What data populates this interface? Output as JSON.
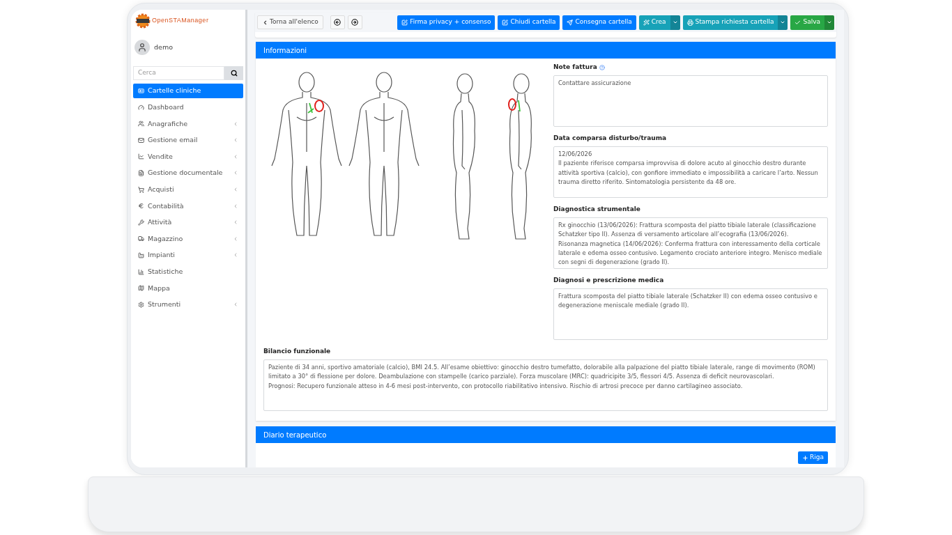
{
  "app": {
    "logo": "OpenSTAManager",
    "user": "demo",
    "search": {
      "placeholder": "Cerca"
    }
  },
  "sidebar": {
    "items": [
      {
        "label": "Cartelle cliniche",
        "selected": true,
        "expandable": false
      },
      {
        "label": "Dashboard",
        "selected": false,
        "expandable": false
      },
      {
        "label": "Anagrafiche",
        "selected": false,
        "expandable": true
      },
      {
        "label": "Gestione email",
        "selected": false,
        "expandable": true
      },
      {
        "label": "Vendite",
        "selected": false,
        "expandable": true
      },
      {
        "label": "Gestione documentale",
        "selected": false,
        "expandable": true
      },
      {
        "label": "Acquisti",
        "selected": false,
        "expandable": true
      },
      {
        "label": "Contabilità",
        "selected": false,
        "expandable": true
      },
      {
        "label": "Attività",
        "selected": false,
        "expandable": true
      },
      {
        "label": "Magazzino",
        "selected": false,
        "expandable": true
      },
      {
        "label": "Impianti",
        "selected": false,
        "expandable": true
      },
      {
        "label": "Statistiche",
        "selected": false,
        "expandable": false
      },
      {
        "label": "Mappa",
        "selected": false,
        "expandable": false
      },
      {
        "label": "Strumenti",
        "selected": false,
        "expandable": true
      }
    ]
  },
  "toolbar": {
    "back": "Torna all'elenco",
    "buttons": [
      {
        "label": "Firma privacy + consenso",
        "kind": "primary",
        "dropdown": false
      },
      {
        "label": "Chiudi cartella",
        "kind": "primary",
        "dropdown": false
      },
      {
        "label": "Consegna cartella",
        "kind": "primary",
        "dropdown": false
      },
      {
        "label": "Crea",
        "kind": "info",
        "dropdown": true
      },
      {
        "label": "Stampa richiesta cartella",
        "kind": "info",
        "dropdown": true
      },
      {
        "label": "Salva",
        "kind": "success",
        "dropdown": true
      }
    ]
  },
  "informazioni": {
    "title": "Informazioni",
    "fields": [
      {
        "label": "Note fattura",
        "help": true,
        "value": "Contattare assicurazione"
      },
      {
        "label": "Data comparsa disturbo/trauma",
        "help": false,
        "value": "12/06/2026\nIl paziente riferisce comparsa improvvisa di dolore acuto al ginocchio destro durante attività sportiva (calcio), con gonfiore immediato e impossibilità a caricare l’arto. Nessun trauma diretto riferito. Sintomatologia persistente da 48 ore."
      },
      {
        "label": "Diagnostica strumentale",
        "help": false,
        "value": "Rx ginocchio (13/06/2026): Frattura scomposta del piatto tibiale laterale (classificazione Schatzker tipo II). Assenza di versamento articolare all’ecografia (13/06/2026).\nRisonanza magnetica (14/06/2026): Conferma frattura con interessamento della corticale laterale e edema osseo contusivo. Legamento crociato anteriore integro. Menisco mediale con segni di degenerazione (grado II)."
      },
      {
        "label": "Diagnosi e prescrizione medica",
        "help": false,
        "value": "Frattura scomposta del piatto tibiale laterale (Schatzker II) con edema osseo contusivo e degenerazione meniscale mediale (grado II)."
      }
    ],
    "bilancio": {
      "label": "Bilancio funzionale",
      "value": "Paziente di 34 anni, sportivo amatoriale (calcio), BMI 24.5. All’esame obiettivo: ginocchio destro tumefatto, dolorabile alla palpazione del piatto tibiale laterale, range di movimento (ROM) limitato a 30° di flessione per dolore. Deambulazione con stampelle (carico parziale). Forza muscolare (MRC): quadricipite 3/5, flessori 4/5. Assenza di deficit neurovascolari.\nPrognosi: Recupero funzionale atteso in 4-6 mesi post-intervento, con protocollo riabilitativo intensivo. Rischio di artrosi precoce per danno cartilagineo associato."
    }
  },
  "diario": {
    "title": "Diario terapeutico",
    "add_button": "Riga"
  }
}
